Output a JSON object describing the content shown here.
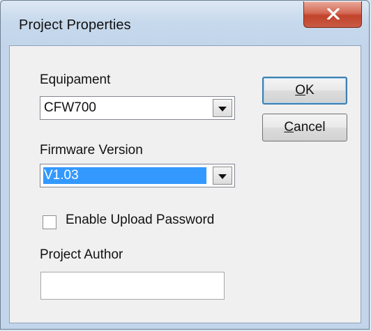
{
  "window": {
    "title": "Project Properties",
    "close_glyph": "X"
  },
  "form": {
    "equipment_label": "Equipament",
    "equipment_value": "CFW700",
    "firmware_label": "Firmware Version",
    "firmware_value": "V1.03",
    "upload_password_label": "Enable Upload Password",
    "upload_password_checked": false,
    "author_label": "Project Author",
    "author_value": ""
  },
  "buttons": {
    "ok_prefix": "",
    "ok_mnemonic": "O",
    "ok_rest": "K",
    "cancel_mnemonic": "C",
    "cancel_rest": "ancel"
  },
  "colors": {
    "selection": "#3399ff",
    "close_button": "#c2432b",
    "dialog_face": "#f0f0f0"
  },
  "icons": {
    "close": "close-icon",
    "dropdown": "chevron-down-icon"
  }
}
